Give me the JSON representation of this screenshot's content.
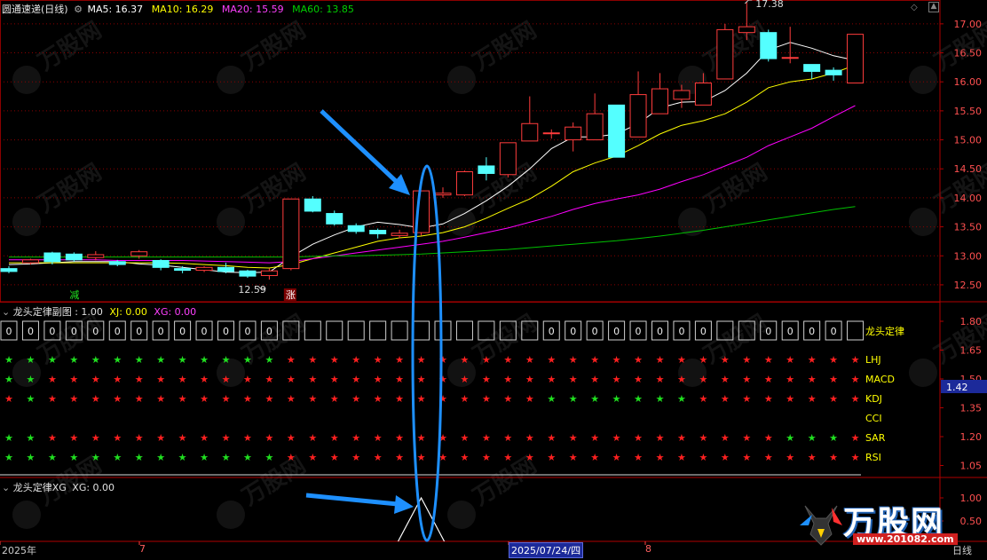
{
  "main_panel": {
    "title": "圆通速递(日线)",
    "indicators": [
      {
        "label": "MA5: 16.37",
        "color": "#ffffff"
      },
      {
        "label": "MA10: 16.29",
        "color": "#ffff00"
      },
      {
        "label": "MA20: 15.59",
        "color": "#ff00ff"
      },
      {
        "label": "MA60: 13.85",
        "color": "#00d000"
      }
    ],
    "axis_ticks": [
      "17.00",
      "16.50",
      "16.00",
      "15.50",
      "15.00",
      "14.50",
      "14.00",
      "13.50",
      "13.00",
      "12.50"
    ],
    "high_label": "17.38",
    "low_label": "12.59",
    "marks": [
      "减",
      "涨"
    ]
  },
  "sub_panel": {
    "title": "龙头定律副图",
    "value_text": ": 1.00",
    "xj_text": "XJ: 0.00",
    "xg_text": "XG: 0.00",
    "axis_ticks": [
      "1.80",
      "1.65",
      "1.50",
      "1.35",
      "1.20",
      "1.05"
    ],
    "row_labels": [
      "龙头定律",
      "LHJ",
      "MACD",
      "KDJ",
      "CCI",
      "SAR",
      "RSI"
    ],
    "cursor_value": "1.42",
    "box_digit": "0"
  },
  "xg_panel": {
    "title": "龙头定律XG",
    "xg_text": "XG: 0.00",
    "axis_ticks": [
      "1.00",
      "0.50"
    ]
  },
  "bottom_axis": {
    "labels": [
      "2025年",
      "7",
      "2025/07/24/四",
      "8"
    ],
    "period": "日线"
  },
  "watermark": {
    "brand": "万股网",
    "url": "www.201082.com"
  },
  "colors": {
    "up": "#ff3c3c",
    "down": "#54ffff",
    "grid": "#8b0000",
    "star_red": "#ff2020",
    "star_green": "#20e020",
    "accent_blue": "#1e90ff"
  },
  "chart_data": {
    "type": "candlestick",
    "title": "圆通速递(日线)",
    "ylim": [
      12.3,
      17.35
    ],
    "series": [
      {
        "name": "MA5",
        "values": [
          12.85,
          12.86,
          12.88,
          12.9,
          12.9,
          12.9,
          12.86,
          12.84,
          12.8,
          12.76,
          12.72,
          12.71,
          12.72,
          12.98,
          13.2,
          13.36,
          13.5,
          13.58,
          13.54,
          13.48,
          13.55,
          13.73,
          13.95,
          14.2,
          14.5,
          14.85,
          15.05,
          15.05,
          15.1,
          15.28,
          15.55,
          15.65,
          15.66,
          15.85,
          16.15,
          16.55,
          16.68,
          16.58,
          16.45,
          16.37
        ]
      },
      {
        "name": "MA10",
        "values": [
          12.88,
          12.88,
          12.88,
          12.88,
          12.88,
          12.88,
          12.88,
          12.88,
          12.87,
          12.85,
          12.83,
          12.8,
          12.79,
          12.85,
          12.95,
          13.05,
          13.15,
          13.25,
          13.31,
          13.34,
          13.4,
          13.5,
          13.65,
          13.82,
          13.98,
          14.2,
          14.45,
          14.6,
          14.72,
          14.9,
          15.1,
          15.25,
          15.33,
          15.45,
          15.65,
          15.9,
          16.0,
          16.05,
          16.15,
          16.29
        ]
      },
      {
        "name": "MA20",
        "values": [
          12.93,
          12.93,
          12.93,
          12.93,
          12.93,
          12.92,
          12.92,
          12.92,
          12.92,
          12.91,
          12.9,
          12.89,
          12.88,
          12.9,
          12.95,
          13.0,
          13.05,
          13.1,
          13.15,
          13.2,
          13.25,
          13.32,
          13.4,
          13.48,
          13.58,
          13.68,
          13.8,
          13.9,
          13.98,
          14.05,
          14.15,
          14.28,
          14.4,
          14.55,
          14.7,
          14.9,
          15.05,
          15.2,
          15.4,
          15.59
        ]
      },
      {
        "name": "MA60",
        "values": [
          12.98,
          12.98,
          12.98,
          12.98,
          12.98,
          12.98,
          12.98,
          12.98,
          12.98,
          12.98,
          12.98,
          12.98,
          12.98,
          12.98,
          12.99,
          13.0,
          13.0,
          13.01,
          13.02,
          13.03,
          13.05,
          13.07,
          13.09,
          13.11,
          13.14,
          13.17,
          13.2,
          13.23,
          13.26,
          13.3,
          13.34,
          13.39,
          13.44,
          13.5,
          13.56,
          13.62,
          13.68,
          13.74,
          13.8,
          13.85
        ]
      }
    ],
    "candles": [
      [
        12.78,
        12.73,
        12.82,
        12.7
      ],
      [
        12.88,
        12.93,
        12.95,
        12.85
      ],
      [
        13.05,
        12.9,
        13.07,
        12.85
      ],
      [
        13.03,
        12.93,
        13.06,
        12.9
      ],
      [
        12.97,
        13.02,
        13.08,
        12.92
      ],
      [
        12.9,
        12.85,
        12.93,
        12.82
      ],
      [
        13.0,
        13.07,
        13.1,
        12.95
      ],
      [
        12.92,
        12.8,
        12.94,
        12.75
      ],
      [
        12.78,
        12.75,
        12.82,
        12.7
      ],
      [
        12.75,
        12.8,
        12.82,
        12.72
      ],
      [
        12.8,
        12.73,
        12.88,
        12.7
      ],
      [
        12.74,
        12.65,
        12.76,
        12.62
      ],
      [
        12.66,
        12.74,
        12.78,
        12.59
      ],
      [
        12.78,
        13.98,
        13.98,
        12.75
      ],
      [
        13.98,
        13.77,
        14.03,
        13.75
      ],
      [
        13.73,
        13.55,
        13.78,
        13.52
      ],
      [
        13.52,
        13.42,
        13.56,
        13.38
      ],
      [
        13.44,
        13.38,
        13.47,
        13.3
      ],
      [
        13.35,
        13.39,
        13.45,
        13.3
      ],
      [
        13.4,
        14.12,
        14.12,
        13.35
      ],
      [
        14.05,
        14.08,
        14.18,
        14.0
      ],
      [
        14.05,
        14.45,
        14.47,
        14.03
      ],
      [
        14.55,
        14.42,
        14.7,
        14.3
      ],
      [
        14.4,
        14.95,
        14.95,
        14.35
      ],
      [
        14.98,
        15.28,
        15.75,
        14.98
      ],
      [
        15.12,
        15.12,
        15.18,
        15.02
      ],
      [
        15.0,
        15.22,
        15.3,
        14.8
      ],
      [
        15.0,
        15.45,
        15.8,
        15.0
      ],
      [
        15.6,
        14.7,
        15.6,
        14.7
      ],
      [
        15.05,
        15.78,
        16.18,
        15.05
      ],
      [
        15.45,
        15.88,
        16.15,
        15.45
      ],
      [
        15.7,
        15.85,
        15.95,
        15.55
      ],
      [
        15.6,
        15.98,
        16.15,
        15.6
      ],
      [
        16.05,
        16.9,
        17.0,
        16.05
      ],
      [
        16.85,
        16.95,
        17.38,
        16.72
      ],
      [
        16.85,
        16.4,
        16.9,
        16.35
      ],
      [
        16.42,
        16.42,
        16.95,
        16.32
      ],
      [
        16.3,
        16.18,
        16.3,
        16.05
      ],
      [
        16.2,
        16.12,
        16.25,
        16.02
      ],
      [
        15.98,
        16.82,
        16.82,
        15.98
      ]
    ],
    "sub_rows": {
      "LHJ": "GGGGGGGGGGGGGRRRRRRRRRRRRRRRRRRRRRRRRRRR",
      "MACD": "GGRRRRRRRRRRRRRRRRRRRRRRRRRRRRRRRRRRRRRR",
      "KDJ": "RGRRRRRRRRRRRRRRRRRRRRRRRGGGGGGGRRRRRRRR",
      "CCI": "",
      "SAR": "GGRRRRRRRRRRRRRRRRRRRRRRRRRRRRRRRRRRGGGR",
      "RSI": "GGGGGGGGGGGGGRRRRRRRRRRRRRRRRRRRRRRRRRRR"
    },
    "box_zero_indices": [
      0,
      1,
      2,
      3,
      4,
      5,
      6,
      7,
      8,
      9,
      10,
      11,
      12,
      25,
      26,
      27,
      28,
      29,
      30,
      31,
      32,
      35,
      36,
      37,
      38
    ],
    "xg_signal_index": 19
  }
}
